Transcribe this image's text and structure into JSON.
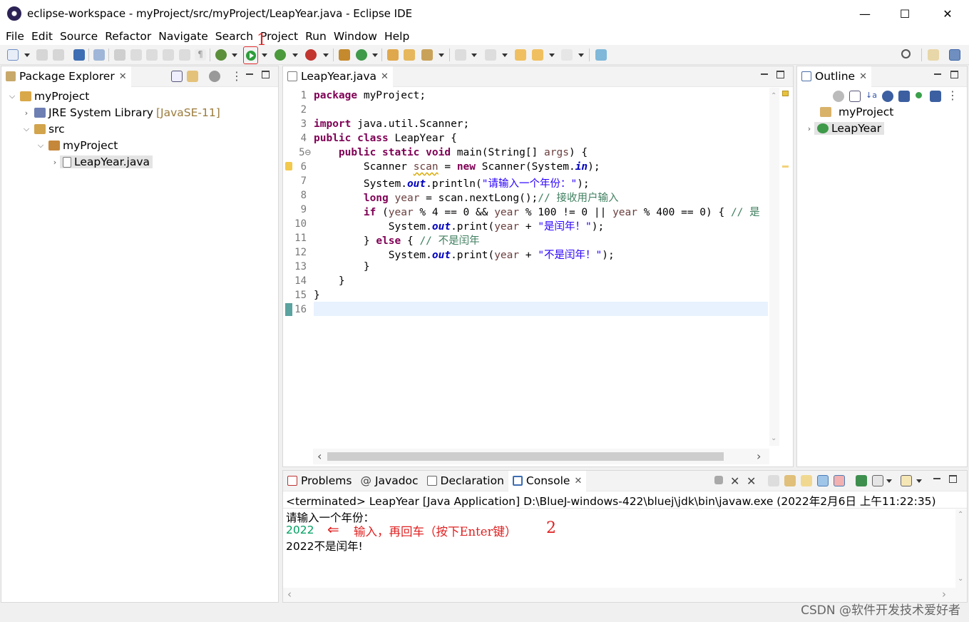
{
  "window": {
    "title": "eclipse-workspace - myProject/src/myProject/LeapYear.java - Eclipse IDE",
    "controls": [
      "—",
      "☐",
      "✕"
    ]
  },
  "menu": [
    "File",
    "Edit",
    "Source",
    "Refactor",
    "Navigate",
    "Search",
    "Project",
    "Run",
    "Window",
    "Help"
  ],
  "annotations": {
    "step1": "1",
    "step2": "2",
    "input_note": "输入，再回车（按下Enter键）",
    "arrow": "⇐"
  },
  "package_explorer": {
    "tab_label": "Package Explorer",
    "tree": {
      "project": "myProject",
      "jre": "JRE System Library",
      "jre_decor": "[JavaSE-11]",
      "src": "src",
      "package": "myProject",
      "file": "LeapYear.java"
    }
  },
  "editor": {
    "tab_label": "LeapYear.java",
    "line_numbers": [
      "1",
      "2",
      "3",
      "4",
      "5⊖",
      "6",
      "7",
      "8",
      "9",
      "10",
      "11",
      "12",
      "13",
      "14",
      "15",
      "16"
    ]
  },
  "outline": {
    "tab_label": "Outline",
    "items": [
      "myProject",
      "LeapYear"
    ]
  },
  "bottom_tabs": {
    "problems": "Problems",
    "javadoc": "Javadoc",
    "declaration": "Declaration",
    "console": "Console"
  },
  "console": {
    "header": "<terminated> LeapYear [Java Application] D:\\BlueJ-windows-422\\bluej\\jdk\\bin\\javaw.exe (2022年2月6日 上午11:22:35)",
    "prompt": "请输入一个年份：",
    "input": "2022",
    "output": "2022不是闰年!"
  },
  "watermark": "CSDN @软件开发技术爱好者",
  "colors": {
    "keyword": "#7f0055",
    "string": "#2a00ff",
    "comment": "#3f7f5f",
    "annotation_red": "#e02020",
    "console_input": "#00a060"
  }
}
